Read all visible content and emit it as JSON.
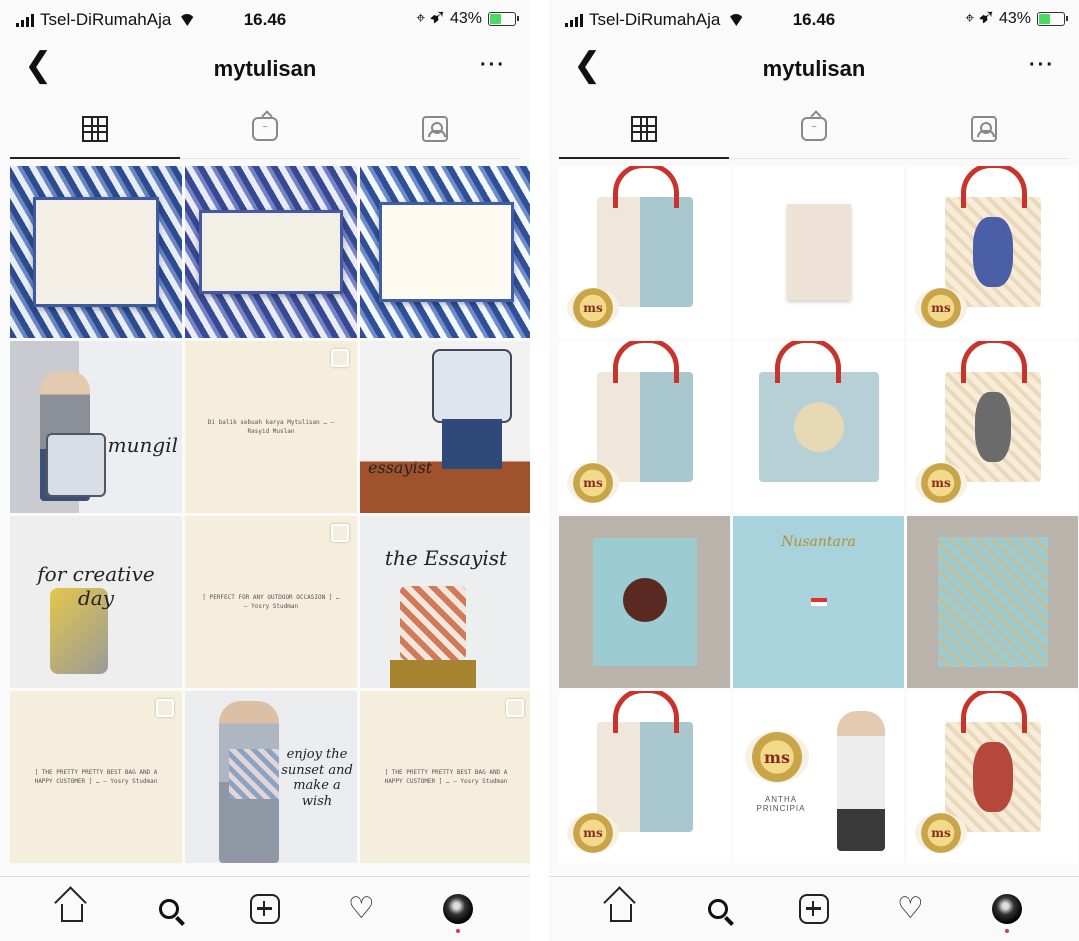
{
  "status_bar": {
    "carrier": "Tsel-DiRumahAja",
    "time": "16.46",
    "battery": "43%",
    "battery_level": 0.43
  },
  "header": {
    "back_icon": "chevron-left-icon",
    "title": "mytulisan",
    "more": "···"
  },
  "tabs": [
    {
      "icon": "grid-icon",
      "active": true
    },
    {
      "icon": "igtv-icon",
      "active": false
    },
    {
      "icon": "tagged-icon",
      "active": false
    }
  ],
  "left_grid": {
    "caption_1": "mungil",
    "caption_2": "essayist",
    "caption_3": "for creative day",
    "caption_4": "the Essayist",
    "caption_5": "enjoy the sunset and make a wish",
    "text_post_1": "Di balik sebuah karya Mytulisan … – Rasyid Muslan",
    "text_post_2": "[ PERFECT FOR ANY OUTDOOR OCCASION ] … – Yosry Studman",
    "text_post_3": "[ THE PRETTY PRETTY BEST BAG AND A HAPPY CUSTOMER ] … – Yosry Studman",
    "text_post_4": "[ THE PRETTY PRETTY BEST BAG AND A HAPPY CUSTOMER ] … – Yosry Studman"
  },
  "right_grid": {
    "brand_mark": "ms",
    "banner_title": "Nusantara",
    "collection_name": "ANTHA PRINCIPIA"
  },
  "bottom_nav": [
    {
      "icon": "home-icon"
    },
    {
      "icon": "search-icon"
    },
    {
      "icon": "add-post-icon"
    },
    {
      "icon": "heart-icon"
    },
    {
      "icon": "profile-avatar-icon"
    }
  ]
}
